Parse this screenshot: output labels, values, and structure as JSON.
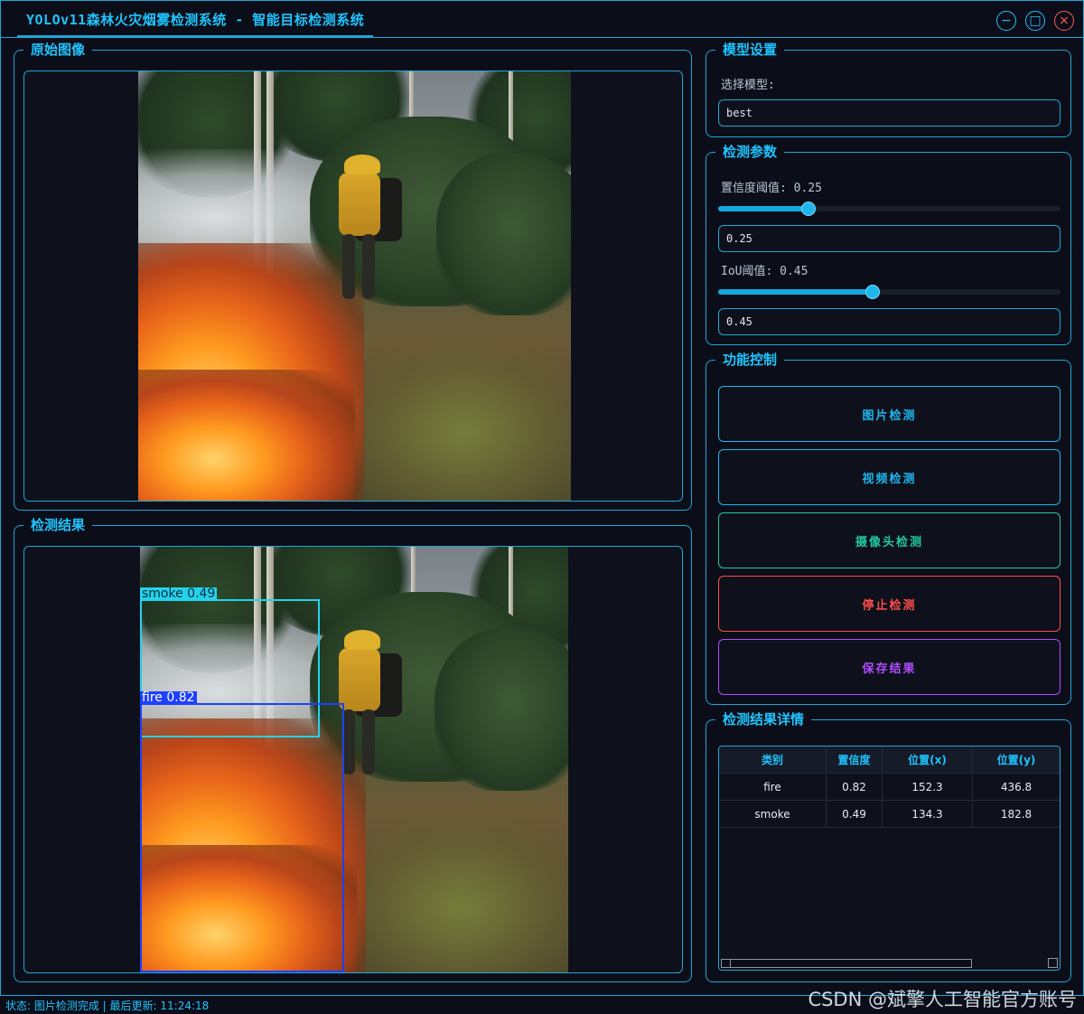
{
  "window": {
    "title": "YOLOv11森林火灾烟雾检测系统 - 智能目标检测系统",
    "controls": {
      "minimize": "−",
      "maximize": "□",
      "close": "×"
    }
  },
  "original_panel": {
    "title": "原始图像"
  },
  "result_panel": {
    "title": "检测结果",
    "detections": [
      {
        "label": "smoke 0.49",
        "color": "#22d3ee"
      },
      {
        "label": "fire 0.82",
        "color": "#1e40ff"
      }
    ]
  },
  "model_settings": {
    "title": "模型设置",
    "select_label": "选择模型:",
    "selected_model": "best"
  },
  "detect_params": {
    "title": "检测参数",
    "confidence_label": "置信度阈值: 0.25",
    "confidence_value": "0.25",
    "confidence_level": 0.25,
    "iou_label": "IoU阈值: 0.45",
    "iou_value": "0.45",
    "iou_level": 0.45
  },
  "function_control": {
    "title": "功能控制",
    "buttons": [
      {
        "label": "图片检测",
        "color": "#1fb6ee"
      },
      {
        "label": "视频检测",
        "color": "#1fb6ee"
      },
      {
        "label": "摄像头检测",
        "color": "#22c8a0"
      },
      {
        "label": "停止检测",
        "color": "#ff4d4d"
      },
      {
        "label": "保存结果",
        "color": "#b04dff"
      }
    ]
  },
  "results_detail": {
    "title": "检测结果详情",
    "columns": [
      "类别",
      "置信度",
      "位置(x)",
      "位置(y)"
    ],
    "rows": [
      [
        "fire",
        "0.82",
        "152.3",
        "436.8"
      ],
      [
        "smoke",
        "0.49",
        "134.3",
        "182.8"
      ]
    ]
  },
  "status_bar": {
    "text": "状态: 图片检测完成 | 最后更新: 11:24:18"
  },
  "watermark": {
    "text": "CSDN @斌擎人工智能官方账号"
  }
}
